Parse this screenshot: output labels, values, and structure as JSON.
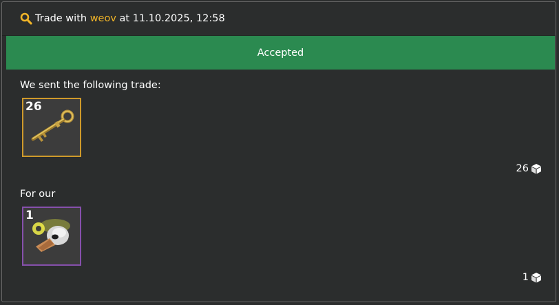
{
  "header": {
    "prefix": "Trade with",
    "partner": "weov",
    "at_text": "at 11.10.2025, 12:58",
    "icon": "search-icon"
  },
  "status": {
    "label": "Accepted",
    "color": "#2b8a50"
  },
  "sent": {
    "label": "We sent the following trade:",
    "items": [
      {
        "name": "key-item",
        "quantity": "26",
        "quality_color": "#cf9a2a"
      }
    ],
    "total": "26",
    "total_icon": "cube-icon"
  },
  "received": {
    "label": "For our",
    "items": [
      {
        "name": "unusual-hat-item",
        "quantity": "1",
        "quality_color": "#8650ac"
      }
    ],
    "total": "1",
    "total_icon": "cube-icon"
  },
  "colors": {
    "background": "#2b2d2d",
    "accent": "#f0b428",
    "item_bg": "#3c3c3c"
  }
}
